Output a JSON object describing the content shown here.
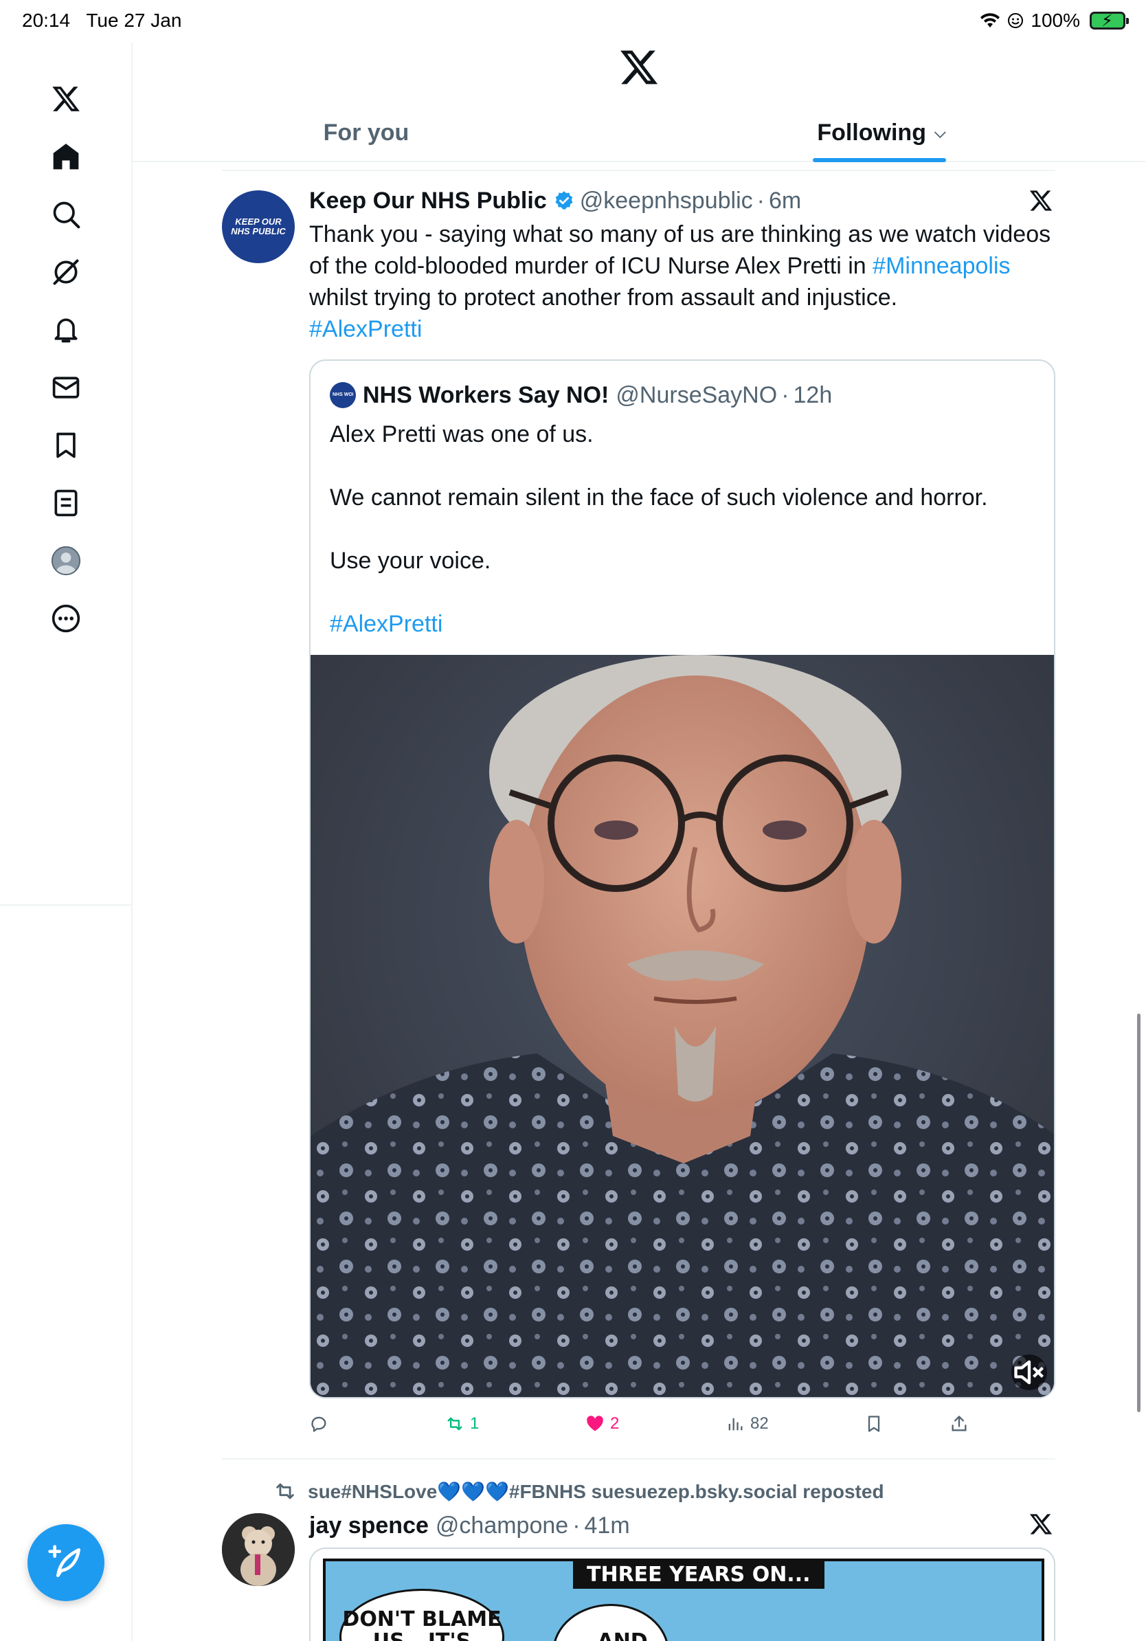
{
  "status_bar": {
    "time": "20:14",
    "date": "Tue 27 Jan",
    "battery": "100%"
  },
  "colors": {
    "accent": "#1d9bf0",
    "text_primary": "#0f1419",
    "text_secondary": "#536471",
    "retweet": "#00ba7c",
    "like": "#f91880"
  },
  "sidebar": {
    "items": [
      {
        "name": "x-logo-icon"
      },
      {
        "name": "home-icon"
      },
      {
        "name": "search-icon"
      },
      {
        "name": "grok-icon"
      },
      {
        "name": "bell-icon"
      },
      {
        "name": "mail-icon"
      },
      {
        "name": "bookmark-icon"
      },
      {
        "name": "lists-icon"
      },
      {
        "name": "profile-avatar-icon"
      },
      {
        "name": "more-icon"
      }
    ],
    "compose_icon": "compose-feather-icon"
  },
  "tabs": [
    {
      "label": "For you",
      "active": false
    },
    {
      "label": "Following",
      "active": true
    }
  ],
  "tweet1": {
    "avatar_text": [
      "KEEP OUR",
      "NHS PUBLIC"
    ],
    "name": "Keep Our NHS Public",
    "handle": "@keepnhspublic",
    "time": "6m",
    "text_lines": [
      "Thank you - saying what so many of us are thinking as we watch videos",
      "of the cold-blooded murder of ICU Nurse Alex Pretti in ",
      "whilst trying to protect another from assault and injustice."
    ],
    "hashtag_inline": "#Minneapolis",
    "hashtag_end": "#AlexPretti",
    "quote": {
      "avatar_text": "NHS WORKERS SAY NO",
      "name": "NHS Workers Say NO!",
      "handle": "@NurseSayNO",
      "time": "12h",
      "paragraphs": [
        "Alex Pretti was one of us.",
        "We cannot remain silent in the face of such violence and horror.",
        "Use your voice."
      ],
      "hashtag": "#AlexPretti"
    },
    "actions": {
      "replies": "",
      "retweets": "1",
      "likes": "2",
      "views": "82"
    }
  },
  "tweet2": {
    "repost_text": "sue#NHSLove💙💙💙#FBNHS suesuezep.bsky.social reposted",
    "name": "jay spence",
    "handle": "@champone",
    "time": "41m",
    "comic": {
      "banner": "THREE YEARS ON...",
      "bubble1": "DON'T BLAME US...IT'S",
      "bubble2": "...AND"
    }
  }
}
